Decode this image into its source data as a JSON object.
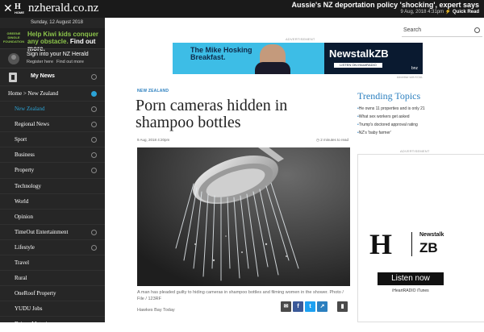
{
  "topbar": {
    "close": "✕",
    "logo": "H",
    "logo_home": "HOME",
    "site": "nzherald.co.nz",
    "breaking_title": "Aussie's NZ deportation policy 'shocking', expert says",
    "breaking_meta": "9 Aug, 2018 4:31pm",
    "quick_read": "Quick Read"
  },
  "sidebar": {
    "date": "Sunday, 12 August 2018",
    "promo_org": "GREENE DINGLE FOUNDATION",
    "promo_text": "Help Kiwi kids conquer any obstacle.",
    "promo_cta": "Find out more.",
    "signin_title": "Sign into your NZ Herald",
    "register": "Register here",
    "find_out": "Find out more",
    "mynews": "My News",
    "nav": [
      "Home > New Zealand",
      "New Zealand",
      "Regional News",
      "Sport",
      "Business",
      "Property",
      "Technology",
      "World",
      "Opinion",
      "TimeOut Entertainment",
      "Lifestyle",
      "Travel",
      "Rural",
      "OneRoof Property",
      "YUDU Jobs",
      "Driven Motoring"
    ]
  },
  "main": {
    "search_label": "Search",
    "ad_label": "ADVERTISEMENT",
    "banner_line": "The Mike Hosking Breakfast.",
    "banner_brand": "NewstalkZB",
    "banner_listen": "LISTEN ON iHeartRADIO",
    "banner_bnz": "bnz",
    "ad_vk": "Advertise with KOAL",
    "section": "NEW ZEALAND",
    "headline": "Porn cameras hidden in shampoo bottles",
    "byline": "9 Aug, 2018 4:20pm",
    "read_time": "2 minutes to read",
    "caption": "A man has pleaded guilty to hiding cameras in shampoo bottles and filming women in the shower. Photo / File / 123RF",
    "credit": "Hawkes Bay Today"
  },
  "trending": {
    "title": "Trending Topics",
    "items": [
      "He owns 11 properties and is only 21",
      "What sex workers get asked",
      "Trump's doctored approval rating",
      "NZ's 'baby farmer'"
    ]
  },
  "ad2": {
    "ad_label": "ADVERTISEMENT",
    "logo": "H",
    "brand_top": "Newstalk",
    "brand_main": "ZB",
    "listen": "Listen now",
    "apps": "iHeartRADIO   iTunes"
  }
}
